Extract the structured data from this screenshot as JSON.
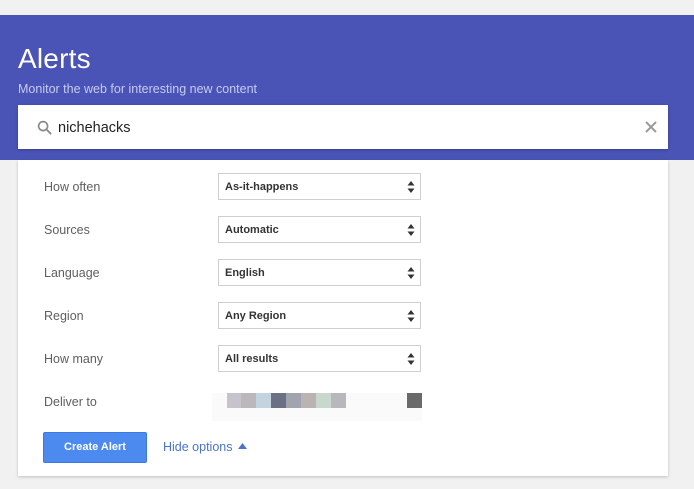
{
  "header": {
    "title": "Alerts",
    "subtitle": "Monitor the web for interesting new content"
  },
  "search": {
    "value": "nichehacks",
    "icon": "search-icon",
    "clear_icon": "close-icon"
  },
  "options": [
    {
      "label": "How often",
      "value": "As-it-happens"
    },
    {
      "label": "Sources",
      "value": "Automatic"
    },
    {
      "label": "Language",
      "value": "English"
    },
    {
      "label": "Region",
      "value": "Any Region"
    },
    {
      "label": "How many",
      "value": "All results"
    }
  ],
  "deliver": {
    "label": "Deliver to"
  },
  "actions": {
    "create_label": "Create Alert",
    "hide_options_label": "Hide options"
  },
  "colors": {
    "header_bg": "#4a54b6",
    "primary_button": "#4d8af0",
    "link": "#4a74cc"
  }
}
